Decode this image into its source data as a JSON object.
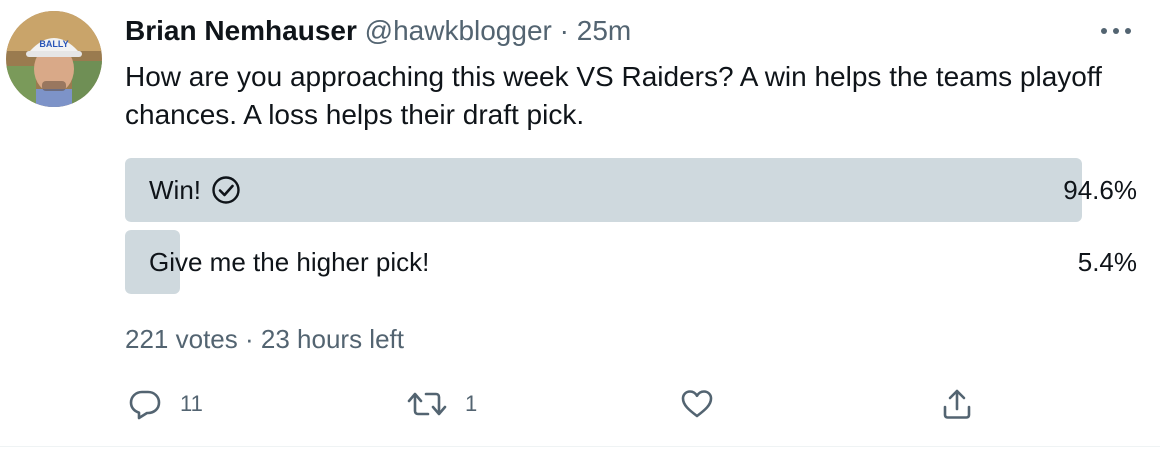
{
  "author": {
    "name": "Brian Nemhauser",
    "handle": "@hawkblogger",
    "separator": "·",
    "time": "25m",
    "avatar_hat_text": "BALLY"
  },
  "tweet": {
    "text": "How are you approaching this week VS Raiders? A win helps the teams playoff chances. A loss helps their draft pick."
  },
  "poll": {
    "options": [
      {
        "label": "Win!",
        "percent_text": "94.6%",
        "percent": 94.6,
        "winner": true
      },
      {
        "label": "Give me the higher pick!",
        "percent_text": "5.4%",
        "percent": 5.4,
        "winner": false
      }
    ],
    "votes": "221 votes",
    "separator": "·",
    "time_left": "23 hours left"
  },
  "actions": {
    "reply_count": "11",
    "retweet_count": "1",
    "like_count": "",
    "share_count": ""
  },
  "icons": {
    "more": "more-icon",
    "check": "check-circle-icon",
    "reply": "reply-icon",
    "retweet": "retweet-icon",
    "like": "like-icon",
    "share": "share-icon"
  },
  "colors": {
    "bar": "#cfd9de",
    "secondary_text": "#536471",
    "primary_text": "#0f1419"
  }
}
